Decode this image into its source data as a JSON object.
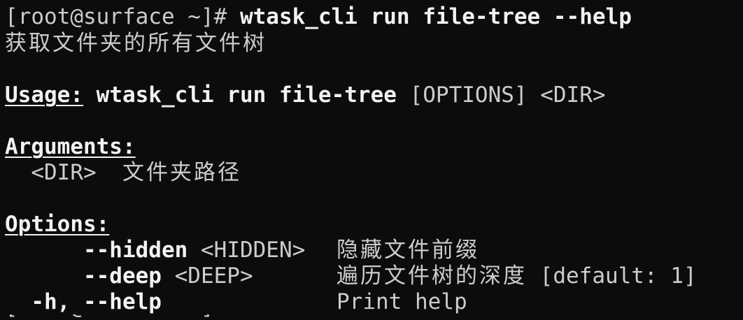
{
  "prompt_line": {
    "prompt": "[root@surface ~]# ",
    "command": "wtask_cli run file-tree --help"
  },
  "description": "获取文件夹的所有文件树",
  "usage": {
    "label": "Usage:",
    "command": "wtask_cli run file-tree",
    "args": " [OPTIONS] <DIR>"
  },
  "arguments": {
    "heading": "Arguments:",
    "items": [
      {
        "name": "<DIR>",
        "desc": "文件夹路径"
      }
    ]
  },
  "options": {
    "heading": "Options:",
    "items": [
      {
        "flag": "--hidden",
        "meta": " <HIDDEN>",
        "desc": "隐藏文件前缀",
        "default": ""
      },
      {
        "flag": "--deep",
        "meta": " <DEEP>",
        "desc": "遍历文件树的深度",
        "default": " [default: 1]"
      },
      {
        "flag": "-h, --help",
        "meta": "",
        "desc": "Print help",
        "default": ""
      }
    ]
  },
  "next_prompt": "[root@surface ~]# "
}
